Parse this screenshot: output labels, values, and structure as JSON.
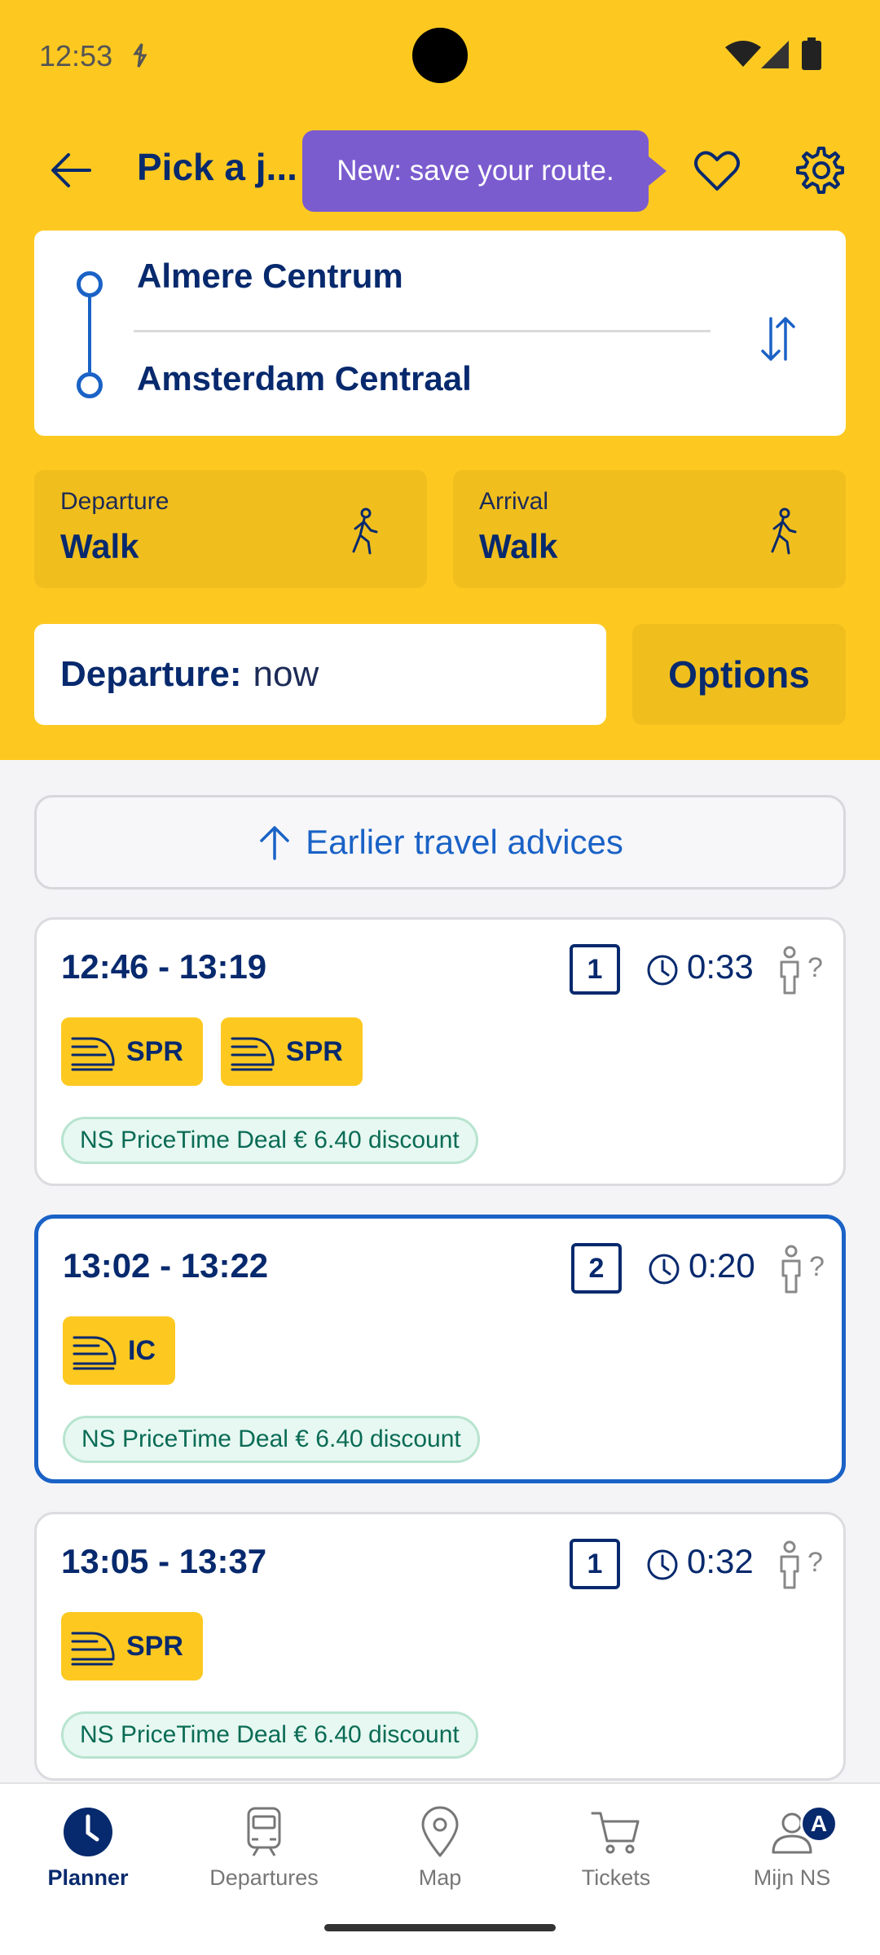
{
  "status_bar": {
    "time": "12:53"
  },
  "header": {
    "title": "Pick a j...",
    "tooltip": "New: save your route."
  },
  "route": {
    "from": "Almere Centrum",
    "to": "Amsterdam Centraal"
  },
  "departure_mode": {
    "label": "Departure",
    "value": "Walk"
  },
  "arrival_mode": {
    "label": "Arrival",
    "value": "Walk"
  },
  "when": {
    "label": "Departure:",
    "value": "now"
  },
  "options_label": "Options",
  "earlier_label": "Earlier travel advices",
  "trips": [
    {
      "times": "12:46 - 13:19",
      "transfers": "1",
      "duration": "0:33",
      "crowd": "?",
      "trains": [
        "SPR",
        "SPR"
      ],
      "deal": "NS PriceTime Deal € 6.40 discount",
      "selected": false
    },
    {
      "times": "13:02 - 13:22",
      "transfers": "2",
      "duration": "0:20",
      "crowd": "?",
      "trains": [
        "IC"
      ],
      "deal": "NS PriceTime Deal € 6.40 discount",
      "selected": true
    },
    {
      "times": "13:05 - 13:37",
      "transfers": "1",
      "duration": "0:32",
      "crowd": "?",
      "trains": [
        "SPR"
      ],
      "deal": "NS PriceTime Deal € 6.40 discount",
      "selected": false
    }
  ],
  "nav": {
    "items": [
      {
        "label": "Planner",
        "icon": "clock-icon",
        "active": true
      },
      {
        "label": "Departures",
        "icon": "train-icon",
        "active": false
      },
      {
        "label": "Map",
        "icon": "map-pin-icon",
        "active": false
      },
      {
        "label": "Tickets",
        "icon": "cart-icon",
        "active": false
      },
      {
        "label": "Mijn NS",
        "icon": "person-icon",
        "active": false
      }
    ],
    "profile_badge": "A"
  },
  "colors": {
    "brand_yellow": "#fdc921",
    "brand_blue": "#07296d",
    "accent_blue": "#1a62c6",
    "tooltip_purple": "#7b5ccf"
  }
}
